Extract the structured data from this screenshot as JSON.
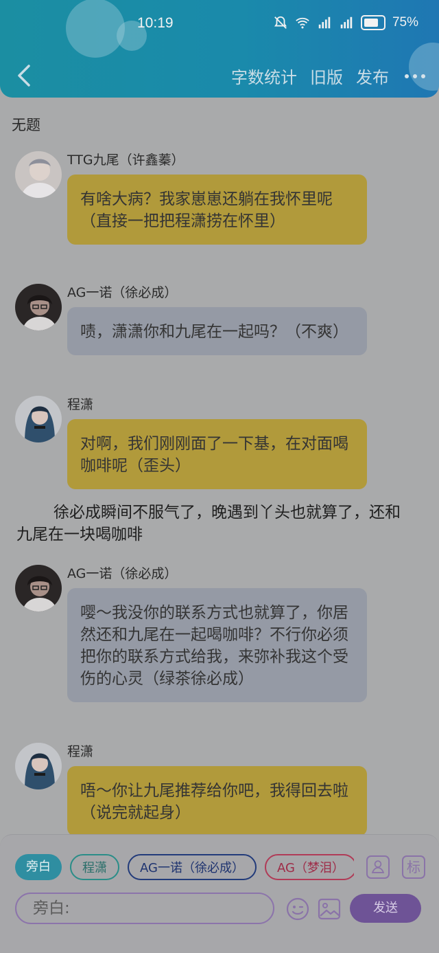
{
  "status_bar": {
    "time": "10:19",
    "battery": "75%"
  },
  "header": {
    "nav": [
      "字数统计",
      "旧版",
      "发布"
    ]
  },
  "document": {
    "title": "无题"
  },
  "messages": [
    {
      "speaker": "TTG九尾（许鑫蓁）",
      "text": "有啥大病？我家崽崽还躺在我怀里呢（直接一把把程潇捞在怀里）",
      "color": "yellow"
    },
    {
      "speaker": "AG一诺（徐必成）",
      "text": "啧，潇潇你和九尾在一起吗？（不爽）",
      "color": "gray"
    },
    {
      "speaker": "程潇",
      "text": "对啊，我们刚刚面了一下基，在对面喝咖啡呢（歪头）",
      "color": "yellow"
    },
    {
      "speaker": "AG一诺（徐必成）",
      "text": "嘤～我没你的联系方式也就算了，你居然还和九尾在一起喝咖啡？不行你必须把你的联系方式给我，来弥补我这个受伤的心灵（绿茶徐必成）",
      "color": "gray"
    },
    {
      "speaker": "程潇",
      "text": "唔～你让九尾推荐给你吧，我得回去啦（说完就起身）",
      "color": "yellow"
    }
  ],
  "narration": "徐必成瞬间不服气了，晚遇到丫头也就算了，还和九尾在一块喝咖啡",
  "composer": {
    "chips": [
      "旁白",
      "程潇",
      "AG一诺（徐必成）",
      "AG（梦泪）"
    ],
    "tag_icon_label": "标",
    "input_placeholder": "旁白:",
    "send_label": "发送"
  },
  "colors": {
    "header": "#1b8ea2",
    "bubble_yellow": "#b19a3b",
    "bubble_gray": "#959aa5",
    "send": "#6e5396"
  }
}
